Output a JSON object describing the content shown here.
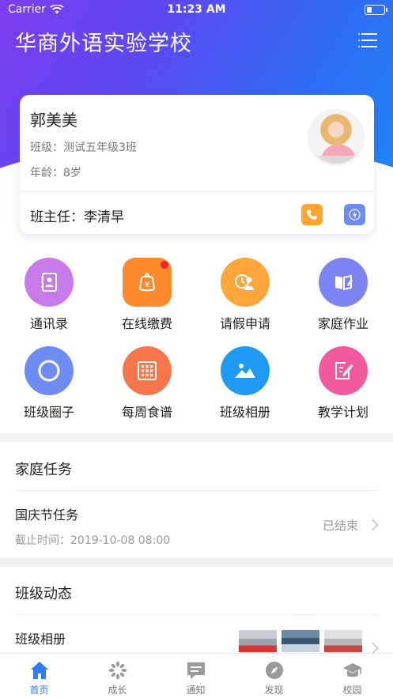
{
  "status_bar": {
    "carrier": "Carrier",
    "time": "11:23 AM"
  },
  "header": {
    "school_name": "华商外语实验学校"
  },
  "profile": {
    "name": "郭美美",
    "class_label": "班级：",
    "class_value": "测试五年级3班",
    "age_label": "年龄：",
    "age_value": "8岁",
    "teacher_label": "班主任：",
    "teacher_value": "李清早"
  },
  "features": [
    {
      "label": "通讯录",
      "color": "#c77be8"
    },
    {
      "label": "在线缴费",
      "color": "#ff8a2b"
    },
    {
      "label": "请假申请",
      "color": "#ffa53a"
    },
    {
      "label": "家庭作业",
      "color": "#7b84f2"
    },
    {
      "label": "班级圈子",
      "color": "#6f8cf5"
    },
    {
      "label": "每周食谱",
      "color": "#f7754a"
    },
    {
      "label": "班级相册",
      "color": "#1e9af5"
    },
    {
      "label": "教学计划",
      "color": "#f25aa0"
    }
  ],
  "home_task": {
    "section_title": "家庭任务",
    "task_name": "国庆节任务",
    "deadline_label": "截止时间：",
    "deadline_value": "2019-10-08 08:00",
    "status": "已结束"
  },
  "class_news": {
    "section_title": "班级动态",
    "album_label": "班级相册"
  },
  "tabs": [
    {
      "label": "首页",
      "icon": "home-icon",
      "active": true
    },
    {
      "label": "成长",
      "icon": "growth-icon",
      "active": false
    },
    {
      "label": "通知",
      "icon": "notice-icon",
      "active": false
    },
    {
      "label": "发现",
      "icon": "compass-icon",
      "active": false
    },
    {
      "label": "校园",
      "icon": "campus-icon",
      "active": false
    }
  ],
  "colors": {
    "accent": "#2f7cf6",
    "phone": "#ffa530",
    "message": "#6c8cf7",
    "badge": "#e8262f"
  }
}
